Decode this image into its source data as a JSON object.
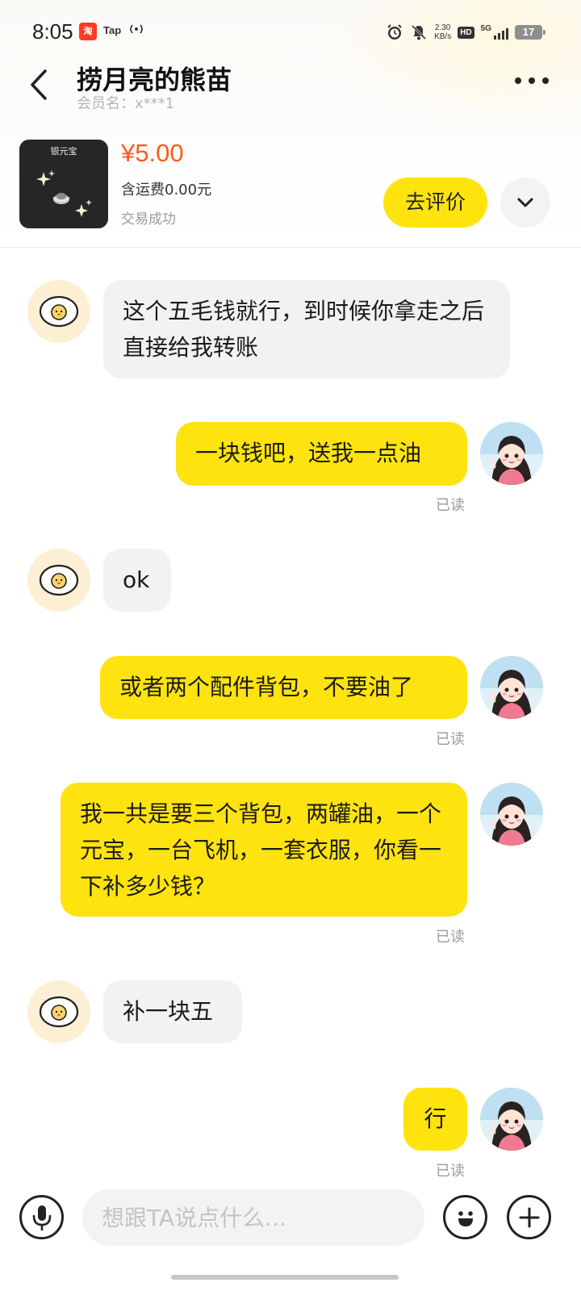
{
  "status_bar": {
    "time": "8:05",
    "taobao_badge": "淘",
    "tap_badge": "Tap",
    "net_speed_value": "2.30",
    "net_speed_unit": "KB/s",
    "hd_label": "HD",
    "network_label": "5G",
    "battery": "17"
  },
  "header": {
    "title": "捞月亮的熊苗",
    "subtitle": "会员名：x***1"
  },
  "product": {
    "image_label": "银元宝",
    "price": "¥5.00",
    "shipping": "含运费0.00元",
    "status": "交易成功",
    "review_button": "去评价"
  },
  "messages": [
    {
      "sender": "other",
      "text": "这个五毛钱就行，到时候你拿走之后直接给我转账"
    },
    {
      "sender": "self",
      "text": "一块钱吧，送我一点油",
      "read": "已读"
    },
    {
      "sender": "other",
      "text": "ok"
    },
    {
      "sender": "self",
      "text": "或者两个配件背包，不要油了",
      "read": "已读"
    },
    {
      "sender": "self",
      "text": "我一共是要三个背包，两罐油，一个元宝，一台飞机，一套衣服，你看一下补多少钱？",
      "read": "已读"
    },
    {
      "sender": "other",
      "text": "补一块五"
    },
    {
      "sender": "self",
      "text": "行",
      "read": "已读"
    }
  ],
  "input": {
    "placeholder": "想跟TA说点什么..."
  },
  "colors": {
    "accent_yellow": "#ffe30f",
    "price_orange": "#ff5a1f",
    "bubble_gray": "#f2f2f4"
  }
}
